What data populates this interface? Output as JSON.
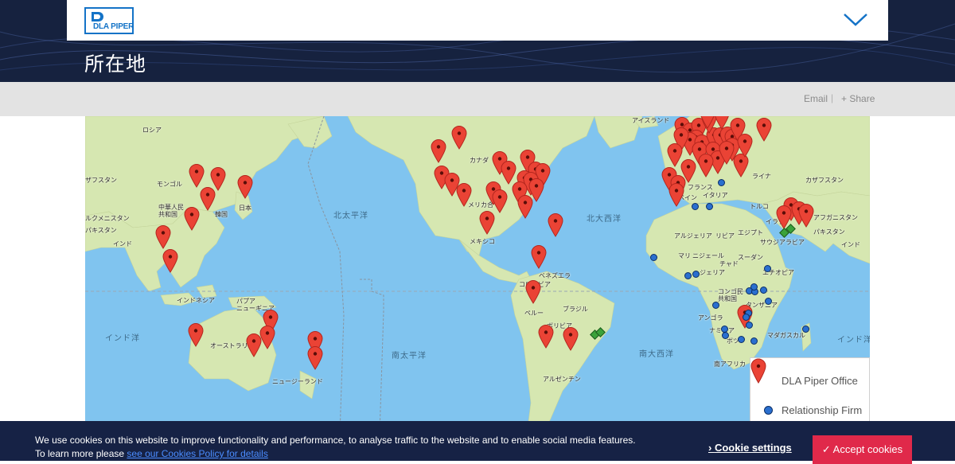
{
  "header": {
    "logo_text": "DLA PIPER",
    "page_title": "所在地",
    "menu_icon": "chevron-down-icon"
  },
  "utility": {
    "email": "Email",
    "separator": "|",
    "share": "+ Share"
  },
  "map": {
    "labels": {
      "russia": "ロシア",
      "kazakhstan_w": "ザフスタン",
      "mongolia": "モンゴル",
      "china": "中華人民\n共和国",
      "korea": "韓国",
      "japan": "日本",
      "turkmenistan_w": "ルクメニスタン",
      "pakistan_w": "パキスタン",
      "india_w": "インド",
      "indonesia": "インドネシア",
      "papua": "パプア\nニューギニア",
      "australia": "オーストラリア",
      "newzealand": "ニュージーランド",
      "canada": "カナダ",
      "usa": "メリカ合",
      "mexico": "メキシコ",
      "venezuela": "ベネズエラ",
      "colombia": "コロンビア",
      "peru": "ペルー",
      "brazil": "ブラジル",
      "bolivia": "ボリビア",
      "argentina": "アルゼンチン",
      "iceland": "アイスランド",
      "france": "フランス",
      "italy": "イタリア",
      "spain": "ペイン",
      "ukraine": "ライナ",
      "kazakhstan_e": "カザフスタン",
      "turkey": "トルコ",
      "iraq": "イラク",
      "afghanistan": "アフガニスタン",
      "pakistan_e": "パキスタン",
      "india_e": "インド",
      "algeria": "アルジェリア",
      "libya": "リビア",
      "egypt": "エジプト",
      "saudi": "サウジアラビア",
      "mali": "マリ",
      "niger": "ニジェール",
      "chad": "チャド",
      "sudan": "スーダン",
      "nigeria": "ジェリア",
      "ethiopia": "エチオピア",
      "congo": "コンゴ民\n共和国",
      "tanzania": "タンザニア",
      "angola": "アンゴラ",
      "namibia": "ナミビア",
      "botswana": "ボツ",
      "madagascar": "マダガスカル",
      "southafrica": "南アフリカ"
    },
    "oceans": {
      "north_pacific": "北太平洋",
      "south_pacific": "南太平洋",
      "north_atlantic": "北大西洋",
      "south_atlantic": "南大西洋",
      "indian_w": "インド洋",
      "indian_e": "インド洋"
    },
    "legend": {
      "office": "DLA Piper Office",
      "relationship": "Relationship Firm"
    }
  },
  "cookies": {
    "text": "We use cookies on this website to improve functionality and performance, to analyse traffic to the website and to enable social media features. To learn more please ",
    "link": "see our Cookies Policy for details",
    "settings": "Cookie settings",
    "accept": "✓ Accept cookies"
  },
  "colors": {
    "brand": "#1473c7",
    "hero": "#16223f",
    "ocean": "#80c4ef",
    "land": "#d6e7b1",
    "pin": "#ea4335",
    "relationship": "#2a6fcf",
    "accept": "#e0294a"
  }
}
